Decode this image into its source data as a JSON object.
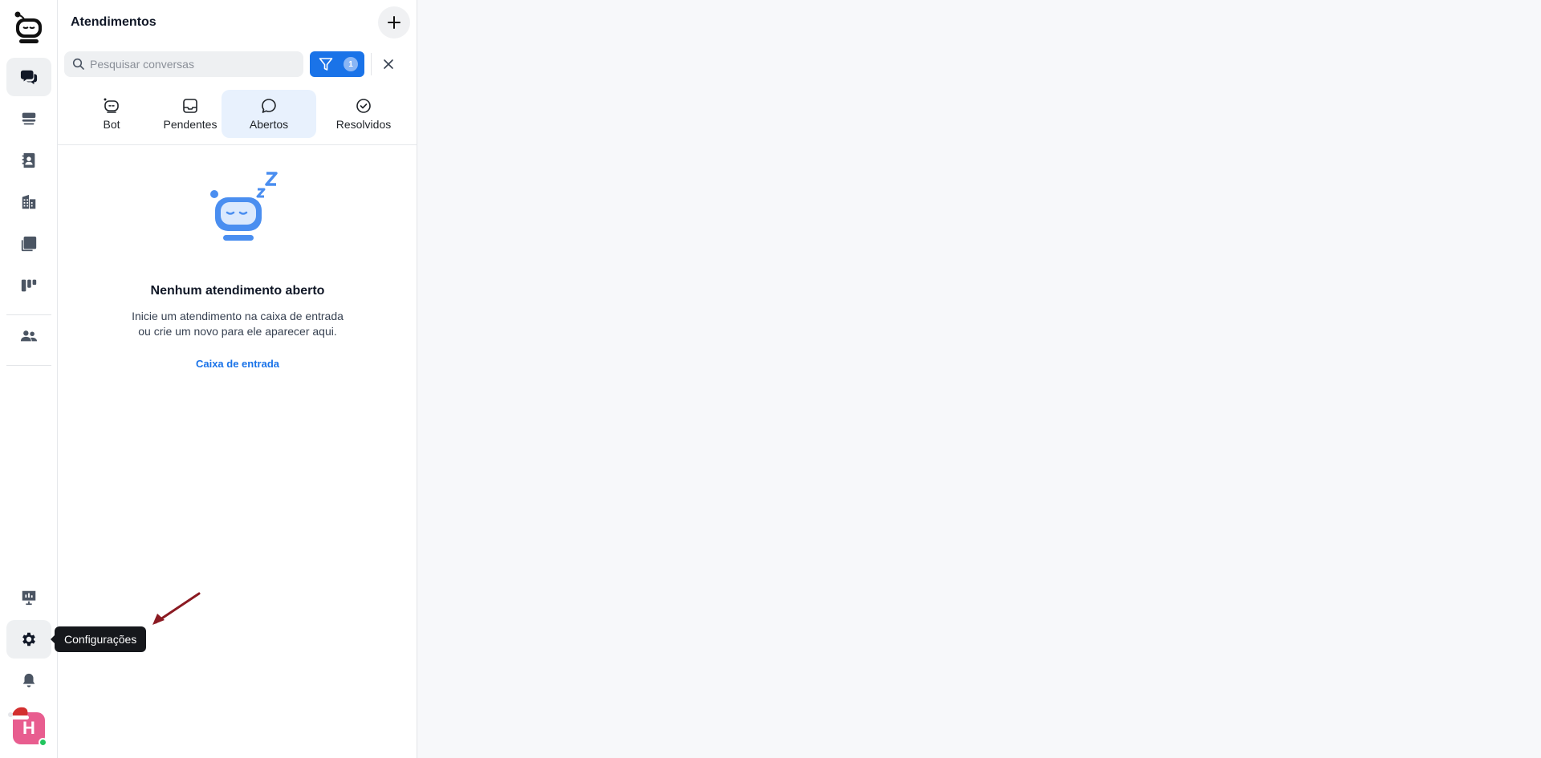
{
  "sidebar": {
    "items": [
      {
        "icon": "chat-bubbles-icon",
        "active": true
      },
      {
        "icon": "inbox-stack-icon",
        "active": false
      },
      {
        "icon": "contact-book-icon",
        "active": false
      },
      {
        "icon": "building-icon",
        "active": false
      },
      {
        "icon": "tasks-check-icon",
        "active": false
      },
      {
        "icon": "kanban-board-icon",
        "active": false
      },
      {
        "icon": "team-people-icon",
        "active": false
      }
    ],
    "bottom_items": [
      {
        "icon": "presentation-chart-icon"
      },
      {
        "icon": "gear-icon"
      },
      {
        "icon": "bell-icon"
      }
    ],
    "avatar_initial": "H",
    "tooltip": "Configurações"
  },
  "panel": {
    "title": "Atendimentos",
    "search_placeholder": "Pesquisar conversas",
    "filter_count": "1",
    "tabs": [
      {
        "label": "Bot",
        "icon": "bot-face-icon",
        "active": false
      },
      {
        "label": "Pendentes",
        "icon": "inbox-tray-icon",
        "active": false
      },
      {
        "label": "Abertos",
        "icon": "chat-bubble-icon",
        "active": true
      },
      {
        "label": "Resolvidos",
        "icon": "check-circle-icon",
        "active": false
      }
    ],
    "empty_state": {
      "title": "Nenhum atendimento aberto",
      "description_line1": "Inicie um atendimento na caixa de entrada",
      "description_line2": "ou crie um novo para ele aparecer aqui.",
      "link": "Caixa de entrada"
    }
  },
  "colors": {
    "accent": "#1a73e8",
    "active_tab_bg": "#e8f1fd",
    "tooltip_bg": "#16181c",
    "arrow": "#8b1a22"
  }
}
